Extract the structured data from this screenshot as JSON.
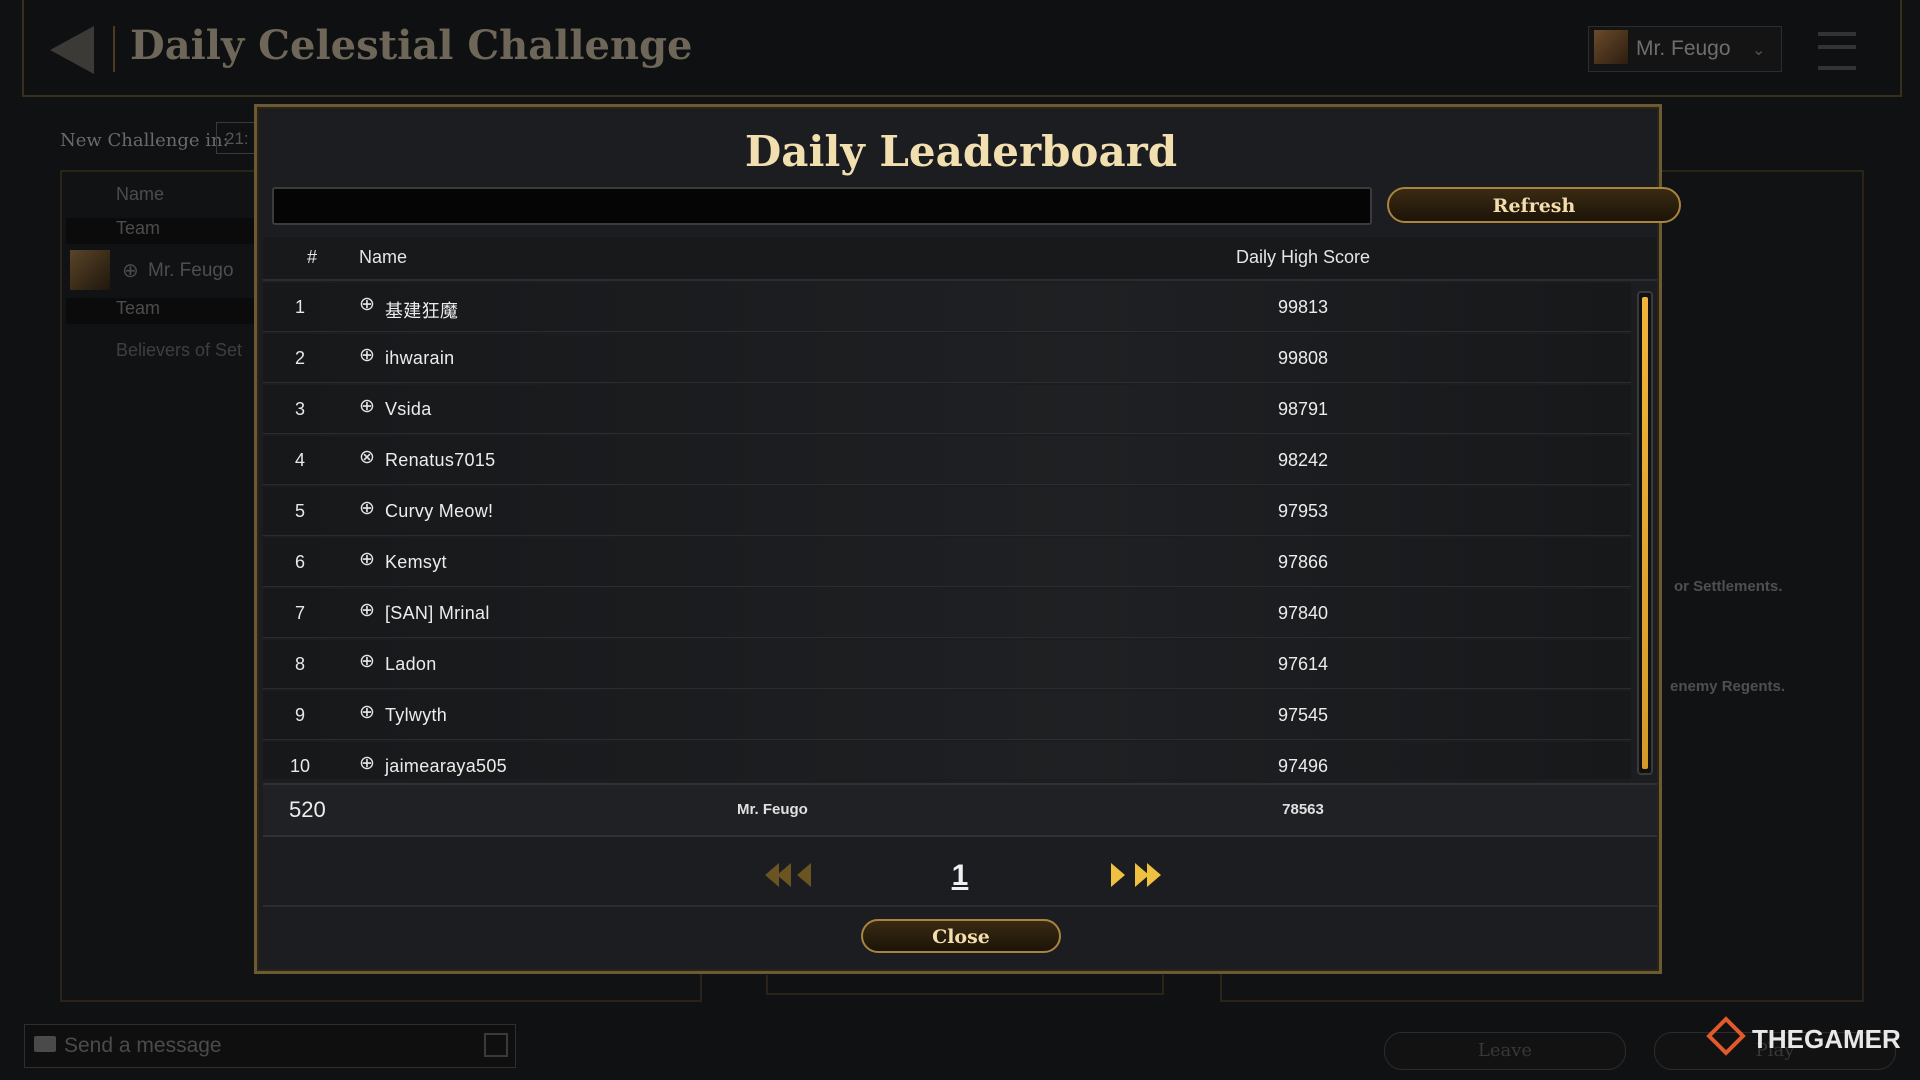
{
  "background": {
    "page_title": "Daily Celestial Challenge",
    "profile_name": "Mr. Feugo",
    "new_challenge_label": "New Challenge in:",
    "timer_value": "21:",
    "left_panel": {
      "header": "Name",
      "team_label_1": "Team",
      "player_name": "Mr. Feugo",
      "team_label_2": "Team",
      "group_name": "Believers of Set"
    },
    "right_panel": {
      "text_1": "or Settlements.",
      "text_2": "enemy Regents."
    },
    "chat_placeholder": "Send a message",
    "leave_label": "Leave",
    "play_label": "Play"
  },
  "watermark": "THEGAMER",
  "modal": {
    "title": "Daily Leaderboard",
    "search_value": "",
    "refresh_label": "Refresh",
    "columns": {
      "rank": "#",
      "name": "Name",
      "score": "Daily High Score"
    },
    "rows": [
      {
        "rank": "1",
        "platform": "globe-icon",
        "name": "基建狂魔",
        "score": "99813"
      },
      {
        "rank": "2",
        "platform": "globe-icon",
        "name": "ihwarain",
        "score": "99808"
      },
      {
        "rank": "3",
        "platform": "globe-icon",
        "name": "Vsida",
        "score": "98791"
      },
      {
        "rank": "4",
        "platform": "xbox-icon",
        "name": "Renatus7015",
        "score": "98242"
      },
      {
        "rank": "5",
        "platform": "globe-icon",
        "name": "Curvy Meow!",
        "score": "97953"
      },
      {
        "rank": "6",
        "platform": "globe-icon",
        "name": "Kemsyt",
        "score": "97866"
      },
      {
        "rank": "7",
        "platform": "globe-icon",
        "name": "[SAN] Mrinal",
        "score": "97840"
      },
      {
        "rank": "8",
        "platform": "globe-icon",
        "name": "Ladon",
        "score": "97614"
      },
      {
        "rank": "9",
        "platform": "globe-icon",
        "name": "Tylwyth",
        "score": "97545"
      },
      {
        "rank": "10",
        "platform": "globe-icon",
        "name": "jaimearaya505",
        "score": "97496"
      }
    ],
    "self": {
      "rank": "520",
      "name": "Mr. Feugo",
      "score": "78563"
    },
    "page_number": "1",
    "close_label": "Close"
  },
  "colors": {
    "accent_gold": "#f0c040",
    "title_cream": "#f2dfb0",
    "modal_bg": "#1b1d20"
  }
}
